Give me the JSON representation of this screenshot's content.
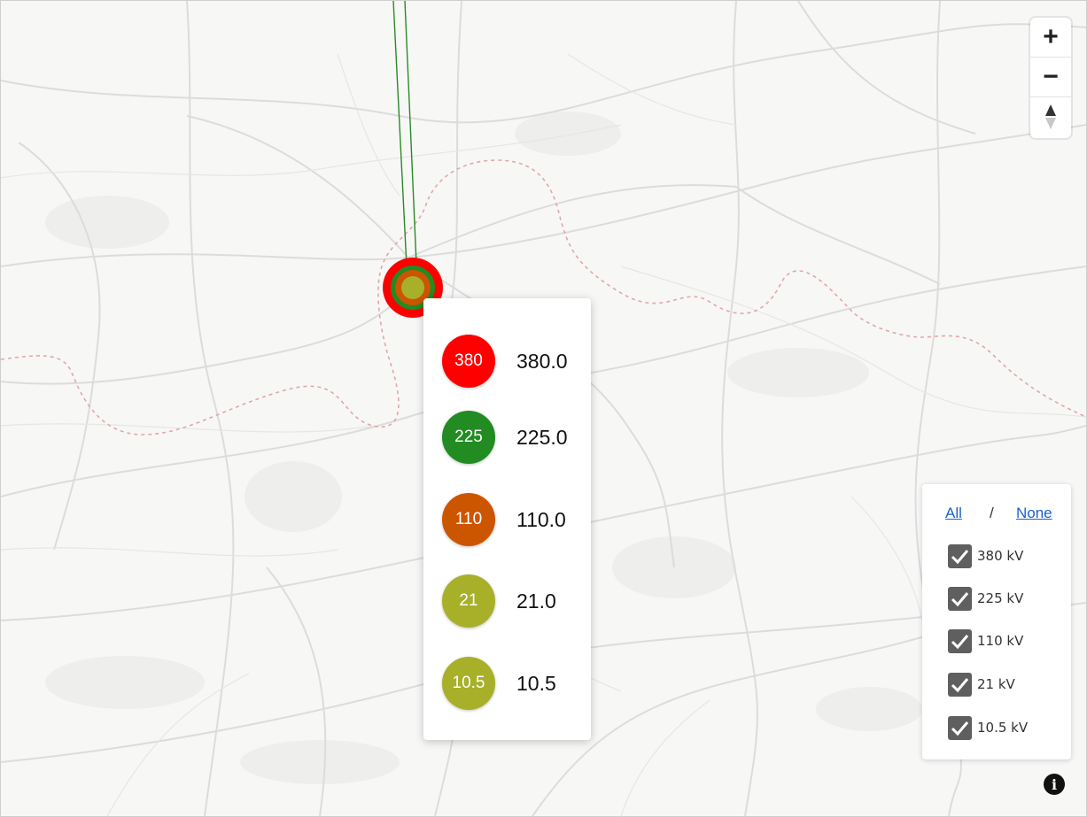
{
  "map": {
    "colors": {
      "background": "#f7f7f6",
      "roads": "#d9d9d9",
      "border": "#e0a8a8",
      "woods": "#ececea",
      "line_green": "#2a8a2a"
    }
  },
  "zoom": {
    "in_glyph": "+",
    "out_glyph": "−",
    "compass_glyph": "▲"
  },
  "substation": {
    "rings": [
      {
        "kv": "380",
        "color": "#ff0000"
      },
      {
        "kv": "225",
        "color": "#228b22"
      },
      {
        "kv": "110",
        "color": "#cc5500"
      },
      {
        "kv": "21",
        "color": "#a8b02a"
      }
    ]
  },
  "popup": {
    "rows": [
      {
        "badge": "380",
        "value": "380.0",
        "color": "#ff0000"
      },
      {
        "badge": "225",
        "value": "225.0",
        "color": "#228b22"
      },
      {
        "badge": "110",
        "value": "110.0",
        "color": "#cc5500"
      },
      {
        "badge": "21",
        "value": "21.0",
        "color": "#a8b02a"
      },
      {
        "badge": "10.5",
        "value": "10.5",
        "color": "#a8b02a"
      }
    ]
  },
  "filter": {
    "all_label": "All",
    "separator": "/",
    "none_label": "None",
    "items": [
      {
        "label": "380 kV",
        "checked": true
      },
      {
        "label": "225 kV",
        "checked": true
      },
      {
        "label": "110 kV",
        "checked": true
      },
      {
        "label": "21 kV",
        "checked": true
      },
      {
        "label": "10.5 kV",
        "checked": true
      }
    ]
  },
  "info": {
    "glyph": "i"
  }
}
